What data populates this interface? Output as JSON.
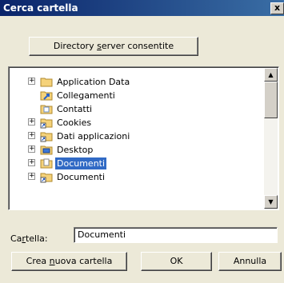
{
  "window": {
    "title": "Cerca cartella",
    "close_glyph": "x"
  },
  "top_button": {
    "pre": "Directory ",
    "accel": "s",
    "post": "erver consentite"
  },
  "tree": {
    "items": [
      {
        "label": "Application Data",
        "icon": "folder-icon",
        "expander": "+",
        "selected": false
      },
      {
        "label": "Collegamenti",
        "icon": "links-folder-icon",
        "expander": "",
        "selected": false
      },
      {
        "label": "Contatti",
        "icon": "contacts-folder-icon",
        "expander": "",
        "selected": false
      },
      {
        "label": "Cookies",
        "icon": "shortcut-folder-icon",
        "expander": "+",
        "selected": false
      },
      {
        "label": "Dati applicazioni",
        "icon": "shortcut-folder-icon",
        "expander": "+",
        "selected": false
      },
      {
        "label": "Desktop",
        "icon": "desktop-folder-icon",
        "expander": "+",
        "selected": false
      },
      {
        "label": "Documenti",
        "icon": "documents-folder-icon",
        "expander": "+",
        "selected": true
      },
      {
        "label": "Documenti",
        "icon": "shortcut-folder-icon",
        "expander": "+",
        "selected": false
      }
    ]
  },
  "folder_field": {
    "label_pre": "Ca",
    "label_accel": "r",
    "label_post": "tella:",
    "value": "Documenti"
  },
  "buttons": {
    "new_folder": {
      "pre": "Crea ",
      "accel": "n",
      "post": "uova cartella"
    },
    "ok": "OK",
    "cancel": "Annulla"
  },
  "colors": {
    "title_bar": "#0a246a",
    "selection": "#316ac5",
    "dialog_bg": "#ece9d8"
  }
}
